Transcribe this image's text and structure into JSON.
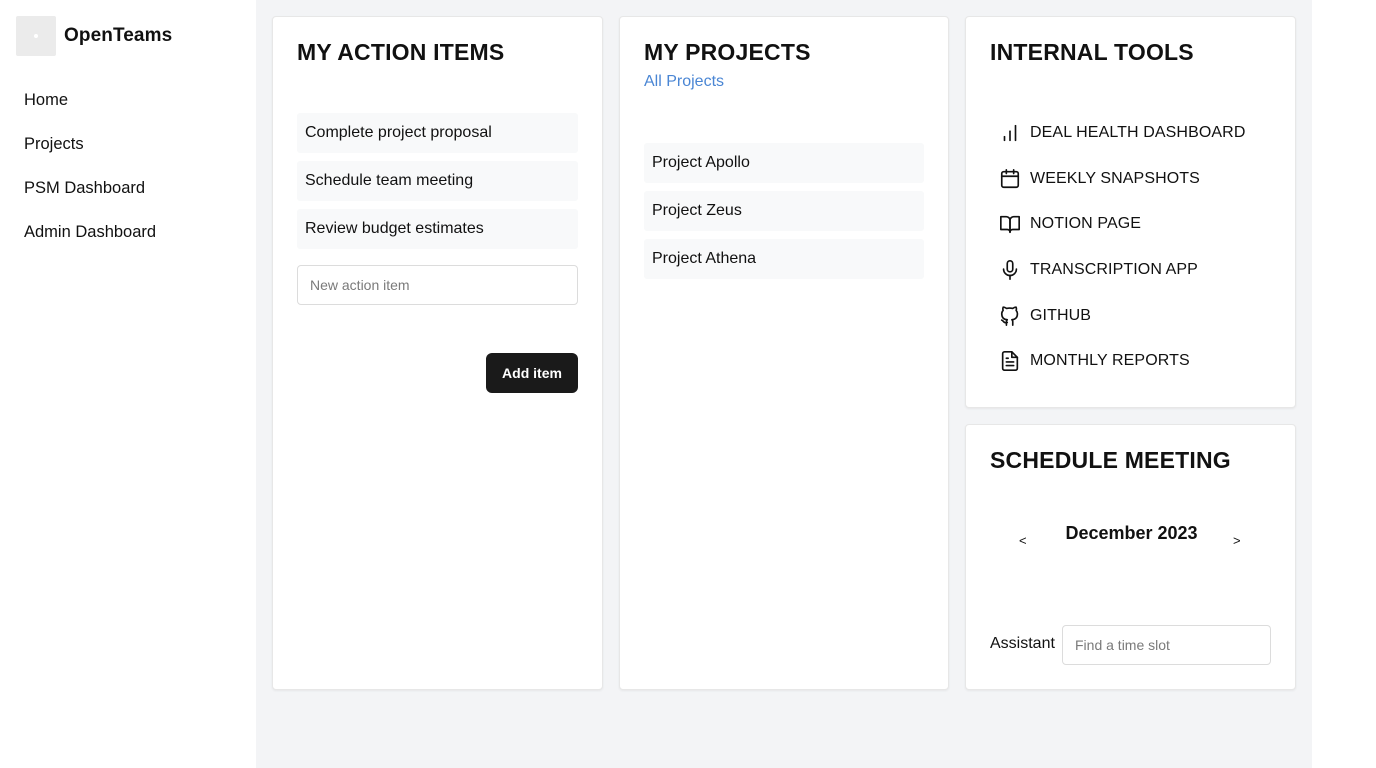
{
  "brand": {
    "name": "OpenTeams"
  },
  "nav": [
    "Home",
    "Projects",
    "PSM Dashboard",
    "Admin Dashboard"
  ],
  "actions": {
    "title": "MY ACTION ITEMS",
    "items": [
      "Complete project proposal",
      "Schedule team meeting",
      "Review budget estimates"
    ],
    "input_placeholder": "New action item",
    "add_label": "Add item"
  },
  "projects": {
    "title": "MY PROJECTS",
    "all_link": "All Projects",
    "items": [
      "Project Apollo",
      "Project Zeus",
      "Project Athena"
    ]
  },
  "tools": {
    "title": "INTERNAL TOOLS",
    "items": [
      {
        "label": "DEAL HEALTH DASHBOARD",
        "icon": "bar-chart-icon"
      },
      {
        "label": "WEEKLY SNAPSHOTS",
        "icon": "calendar-icon"
      },
      {
        "label": "NOTION PAGE",
        "icon": "book-open-icon"
      },
      {
        "label": "TRANSCRIPTION APP",
        "icon": "microphone-icon"
      },
      {
        "label": "GITHUB",
        "icon": "github-icon"
      },
      {
        "label": "MONTHLY REPORTS",
        "icon": "file-text-icon"
      }
    ]
  },
  "schedule": {
    "title": "SCHEDULE MEETING",
    "prev": "<",
    "month": "December 2023",
    "next": ">",
    "assistant_label": "Assistant",
    "assistant_placeholder": "Find a time slot"
  },
  "colors": {
    "link": "#4a86d4",
    "button_bg": "#1a1a1a",
    "main_bg": "#f3f4f6"
  }
}
